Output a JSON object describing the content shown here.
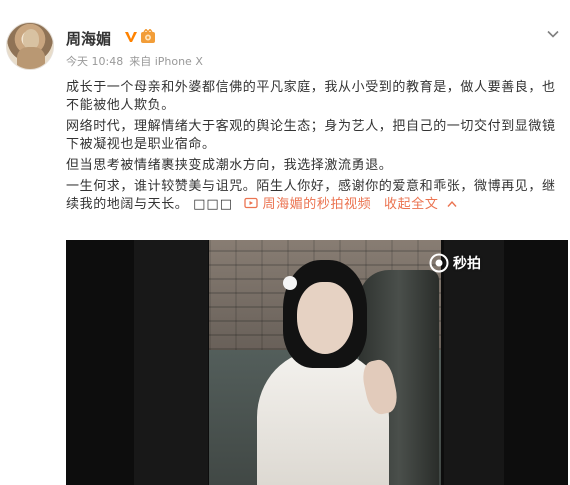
{
  "post": {
    "username": "周海媚",
    "meta": {
      "time": "今天 10:48",
      "source": "来自 iPhone X"
    },
    "body": {
      "p1": "成长于一个母亲和外婆都信佛的平凡家庭，我从小受到的教育是，做人要善良，也不能被他人欺负。",
      "p2": "网络时代，理解情绪大于客观的舆论生态；身为艺人，把自己的一切交付到显微镜下被凝视也是职业宿命。",
      "p3": "但当思考被情绪裹挟变成潮水方向，我选择激流勇退。",
      "p4": "一生何求，谁计较赞美与诅咒。陌生人你好，感谢你的爱意和乖张，微博再见，继续我的地阔与天长。",
      "tofu": "□□□",
      "video_link": "周海媚的秒拍视频",
      "collapse_link": "收起全文"
    },
    "media": {
      "watermark": "秒拍"
    }
  },
  "colors": {
    "link": "#eb7350",
    "meta": "#999999",
    "text": "#333333",
    "vip": "#ff8200"
  },
  "icons": {
    "vip": "vip-v-icon",
    "level": "level-badge-icon",
    "dropdown": "chevron-down-icon",
    "video": "video-icon",
    "collapse": "chevron-up-icon",
    "camera": "camera-icon"
  }
}
